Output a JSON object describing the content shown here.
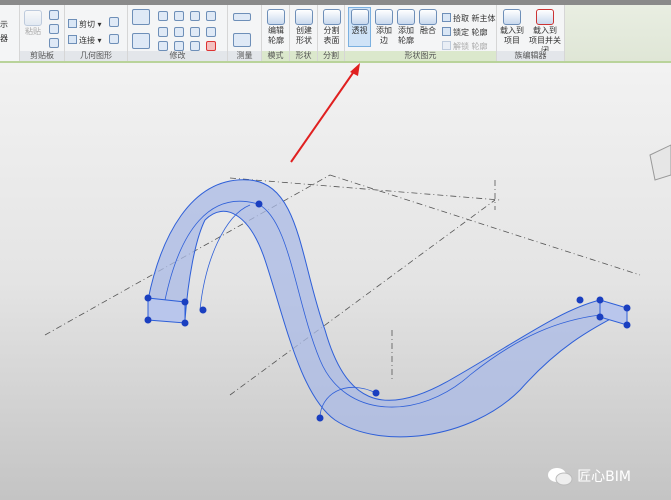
{
  "ribbon": {
    "panels": {
      "partial": {
        "line1": "示",
        "line2": "器"
      },
      "clipboard": {
        "label": "剪贴板",
        "paste": "粘贴"
      },
      "geometry": {
        "label": "几何图形",
        "cut": "剪切",
        "join": "连接"
      },
      "modify": {
        "label": "修改"
      },
      "measure": {
        "label": "测量"
      },
      "mode": {
        "label": "模式",
        "edit_profile_1": "编辑",
        "edit_profile_2": "轮廓"
      },
      "shape": {
        "label": "形状",
        "create_form_1": "创建",
        "create_form_2": "形状"
      },
      "divide": {
        "label": "分割",
        "divide_surface_1": "分割",
        "divide_surface_2": "表面"
      },
      "form_element": {
        "label": "形状图元",
        "xray": "透视",
        "add_edge_1": "添加",
        "add_edge_2": "边",
        "add_profile_1": "添加",
        "add_profile_2": "轮廓",
        "dissolve": "融合",
        "pick_new_host": "拾取 新主体",
        "lock_profile": "锁定 轮廓",
        "unlock_profile": "解锁 轮廓"
      },
      "family_editor": {
        "label": "族编辑器",
        "load_project_1": "载入到",
        "load_project_2": "项目",
        "load_close_1": "载入到",
        "load_close_2": "项目并关闭"
      }
    }
  },
  "colors": {
    "accent": "#2e5fd8",
    "arrow": "#e02020",
    "tube": "#a9b9e6"
  },
  "watermark": {
    "text": "匠心BIM",
    "icon": "wechat-icon"
  }
}
